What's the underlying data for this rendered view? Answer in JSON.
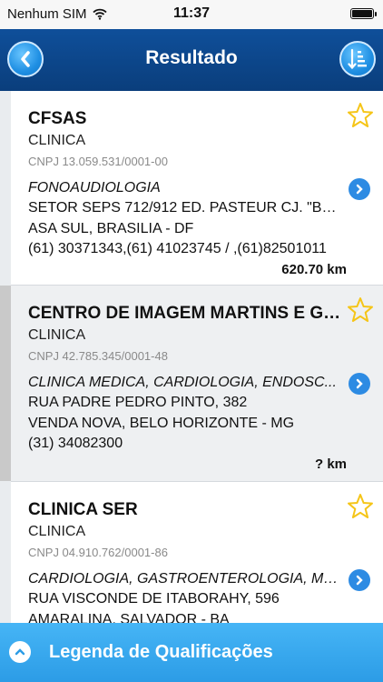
{
  "status": {
    "carrier": "Nenhum SIM",
    "time": "11:37"
  },
  "header": {
    "title": "Resultado"
  },
  "results": [
    {
      "name": "CFSAS",
      "type": "CLINICA",
      "cnpj": "CNPJ 13.059.531/0001-00",
      "specialties": "FONOAUDIOLOGIA",
      "address1": "SETOR SEPS 712/912 ED. PASTEUR CJ. \"B\" ...",
      "address2": "ASA SUL, BRASILIA - DF",
      "phones": "(61) 30371343,(61) 41023745 / ,(61)82501011",
      "distance": "620.70 km"
    },
    {
      "name": "CENTRO DE IMAGEM MARTINS E GOD...",
      "type": "CLINICA",
      "cnpj": "CNPJ 42.785.345/0001-48",
      "specialties": "CLINICA MEDICA, CARDIOLOGIA, ENDOSC...",
      "address1": "RUA PADRE PEDRO PINTO, 382",
      "address2": "VENDA NOVA, BELO HORIZONTE - MG",
      "phones": "(31) 34082300",
      "distance": "? km"
    },
    {
      "name": "CLINICA SER",
      "type": "CLINICA",
      "cnpj": "CNPJ 04.910.762/0001-86",
      "specialties": "CARDIOLOGIA, GASTROENTEROLOGIA, ME...",
      "address1": "RUA VISCONDE DE ITABORAHY, 596",
      "address2": "AMARALINA, SALVADOR - BA"
    }
  ],
  "footer": {
    "legend_label": "Legenda de Qualificações"
  },
  "icons": {
    "star": "star-outline-icon",
    "arrow": "chevron-right-icon",
    "back": "chevron-left-icon",
    "sort": "sort-icon"
  },
  "colors": {
    "header": "#0f4f9a",
    "accent": "#2c9ce6",
    "star": "#f5c518"
  }
}
